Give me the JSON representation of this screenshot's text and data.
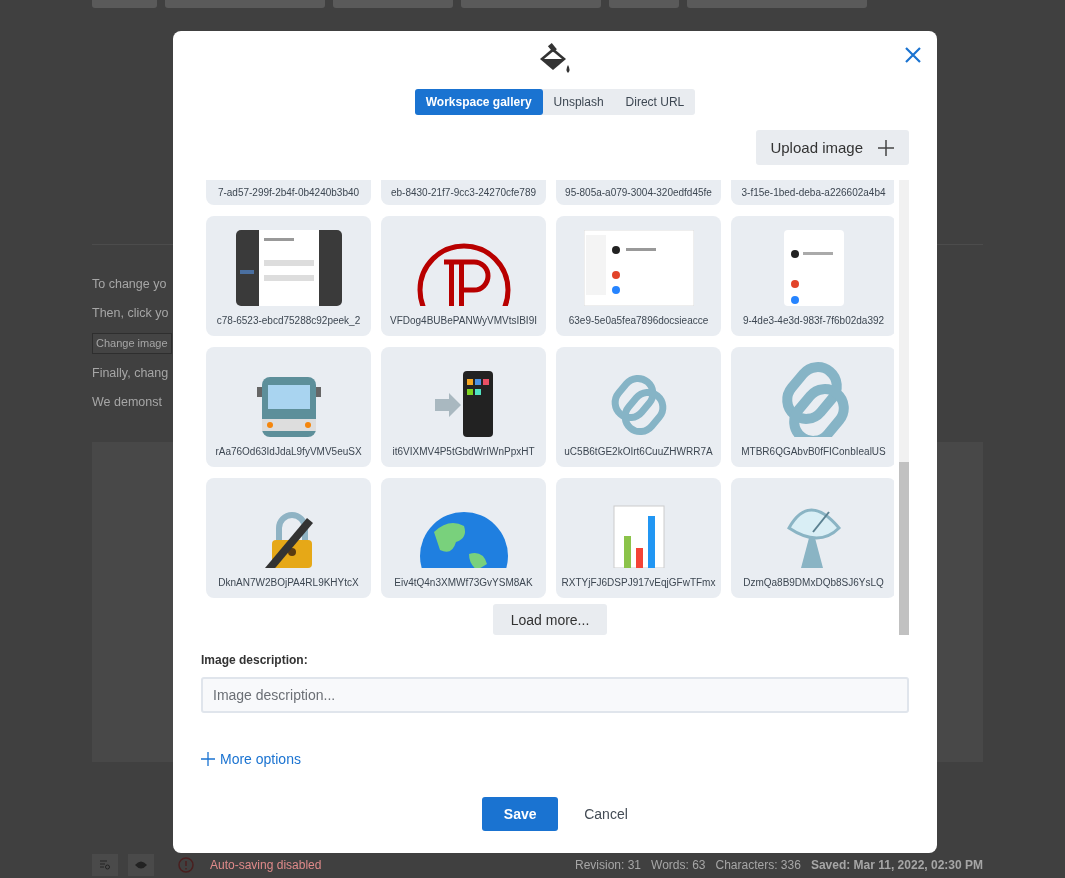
{
  "background_page": {
    "lines": [
      {
        "kind": "text",
        "text": "To change yo"
      },
      {
        "kind": "text",
        "text": "Then, click yo"
      },
      {
        "kind": "button",
        "text": "Change image"
      },
      {
        "kind": "text",
        "text": "Finally, chang"
      },
      {
        "kind": "text",
        "text": "We demonst"
      }
    ]
  },
  "status_bar": {
    "message": "Auto-saving disabled",
    "revision": "Revision: 31",
    "words": "Words: 63",
    "characters": "Characters: 336",
    "saved": "Saved: Mar 11, 2022, 02:30 PM"
  },
  "dialog": {
    "tabs": [
      {
        "label": "Workspace gallery",
        "selected": true
      },
      {
        "label": "Unsplash",
        "selected": false
      },
      {
        "label": "Direct URL",
        "selected": false
      }
    ],
    "upload_button": "Upload image",
    "gallery": {
      "items": [
        {
          "kind": "label-only",
          "filename": "7-ad57-299f-2b4f-0b4240b3b40"
        },
        {
          "kind": "label-only",
          "filename": "eb-8430-21f7-9cc3-24270cfe789"
        },
        {
          "kind": "label-only",
          "filename": "95-805a-a079-3004-320edfd45fe"
        },
        {
          "kind": "label-only",
          "filename": "3-f15e-1bed-deba-a226602a4b4"
        },
        {
          "kind": "picture",
          "filename": "c78-6523-ebcd75288c92peek_2"
        },
        {
          "kind": "picture",
          "filename": "VFDog4BUBePANWyVMVtsIBI9I"
        },
        {
          "kind": "picture",
          "filename": "63e9-5e0a5fea7896docsieacce"
        },
        {
          "kind": "picture",
          "filename": "9-4de3-4e3d-983f-7f6b02da392"
        },
        {
          "kind": "picture",
          "filename": "rAa76Od63IdJdaL9fyVMV5euSX"
        },
        {
          "kind": "picture",
          "filename": "it6VIXMV4P5tGbdWrIWnPpxHT"
        },
        {
          "kind": "picture",
          "filename": "uC5B6tGE2kOIrt6CuuZHWRR7A"
        },
        {
          "kind": "picture",
          "filename": "MTBR6QGAbvB0fFIConbIealUS"
        },
        {
          "kind": "picture",
          "filename": "DknAN7W2BOjPA4RL9KHYtcX"
        },
        {
          "kind": "picture",
          "filename": "Eiv4tQ4n3XMWf73GvYSM8AK"
        },
        {
          "kind": "picture",
          "filename": "RXTYjFJ6DSPJ917vEqjGFwTFmx"
        },
        {
          "kind": "picture",
          "filename": "DzmQa8B9DMxDQb8SJ6YsLQ"
        }
      ],
      "load_more": "Load more..."
    },
    "description": {
      "label": "Image description:",
      "placeholder": "Image description..."
    },
    "more_options": "More options",
    "save": "Save",
    "cancel": "Cancel"
  }
}
